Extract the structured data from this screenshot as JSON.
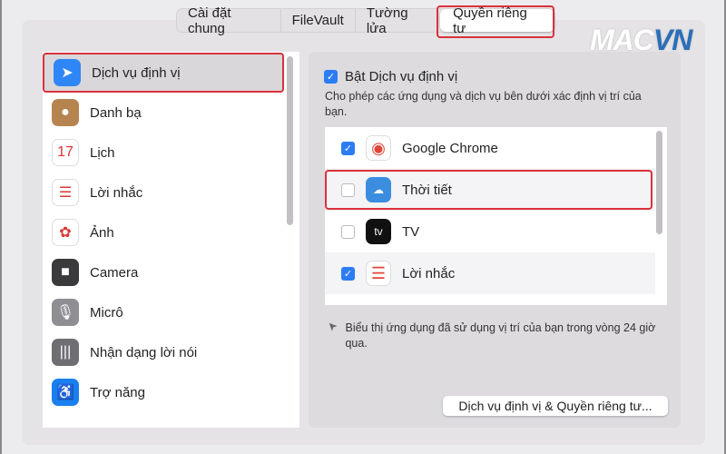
{
  "tabs": [
    {
      "label": "Cài đặt chung"
    },
    {
      "label": "FileVault"
    },
    {
      "label": "Tường lửa"
    },
    {
      "label": "Quyền riêng tư",
      "selected": true
    }
  ],
  "watermark": {
    "text_a": "MAC",
    "text_b": "VN"
  },
  "sidebar": {
    "items": [
      {
        "label": "Dịch vụ định vị",
        "icon": "location-arrow-icon",
        "color": "#2f86f6",
        "glyph": "➤",
        "selected": true
      },
      {
        "label": "Danh bạ",
        "icon": "contacts-icon",
        "color": "#b6854f",
        "glyph": "●"
      },
      {
        "label": "Lịch",
        "icon": "calendar-icon",
        "color": "#ffffff",
        "glyph": "17"
      },
      {
        "label": "Lời nhắc",
        "icon": "reminders-icon",
        "color": "#ffffff",
        "glyph": "☰"
      },
      {
        "label": "Ảnh",
        "icon": "photos-icon",
        "color": "#ffffff",
        "glyph": "✿"
      },
      {
        "label": "Camera",
        "icon": "camera-icon",
        "color": "#3a3a3c",
        "glyph": "■"
      },
      {
        "label": "Micrô",
        "icon": "microphone-icon",
        "color": "#8e8e93",
        "glyph": "🎙"
      },
      {
        "label": "Nhận dạng lời nói",
        "icon": "speech-waveform-icon",
        "color": "#6e6e73",
        "glyph": "|||"
      },
      {
        "label": "Trợ năng",
        "icon": "accessibility-icon",
        "color": "#1a7ff0",
        "glyph": "♿"
      }
    ]
  },
  "main": {
    "enable_label": "Bật Dịch vụ định vị",
    "enable_checked": true,
    "description": "Cho phép các ứng dụng và dịch vụ bên dưới xác định vị trí của bạn.",
    "apps": [
      {
        "name": "Google Chrome",
        "checked": true,
        "icon": "chrome-icon",
        "color": "#ffffff"
      },
      {
        "name": "Thời tiết",
        "checked": false,
        "icon": "weather-icon",
        "color": "#3b8de0"
      },
      {
        "name": "TV",
        "checked": false,
        "icon": "apple-tv-icon",
        "color": "#111111"
      },
      {
        "name": "Lời nhắc",
        "checked": true,
        "icon": "reminders-icon",
        "color": "#ffffff"
      }
    ],
    "hint": "Biểu thị ứng dụng đã sử dụng vị trí của bạn trong vòng 24 giờ qua.",
    "button_label": "Dịch vụ định vị & Quyền riêng tư..."
  }
}
